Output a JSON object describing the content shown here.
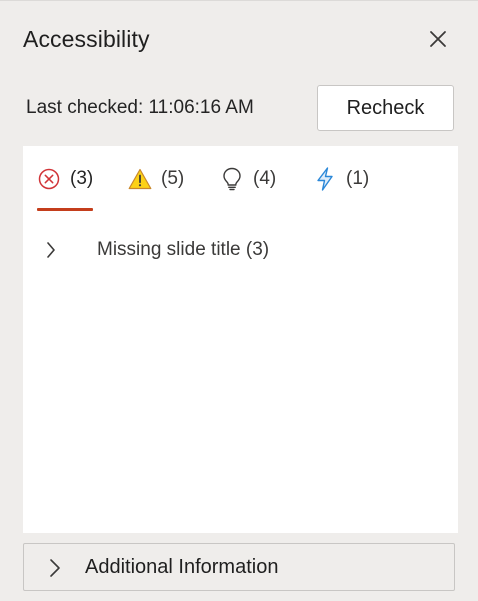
{
  "pane": {
    "title": "Accessibility",
    "close_icon": "close-icon"
  },
  "status": {
    "last_checked": "Last checked: 11:06:16 AM",
    "recheck_label": "Recheck"
  },
  "tabs": [
    {
      "icon": "error-circle-icon",
      "count": "(3)",
      "color": "#d13438",
      "active": true
    },
    {
      "icon": "warning-triangle-icon",
      "count": "(5)",
      "color": "#f7b500",
      "active": false
    },
    {
      "icon": "lightbulb-icon",
      "count": "(4)",
      "color": "#3b3a39",
      "active": false
    },
    {
      "icon": "lightning-icon",
      "count": "(1)",
      "color": "#2b88d8",
      "active": false
    }
  ],
  "accent_color": "#c43e1c",
  "issues": [
    {
      "label": "Missing slide title (3)",
      "icon": "chevron-right-icon"
    }
  ],
  "additional": {
    "label": "Additional Information",
    "icon": "chevron-right-icon"
  }
}
